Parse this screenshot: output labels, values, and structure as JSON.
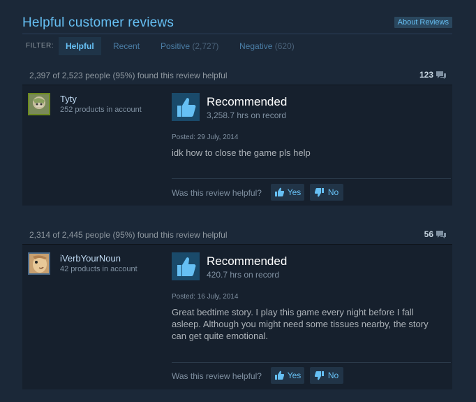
{
  "header": {
    "title": "Helpful customer reviews",
    "about_label": "About Reviews"
  },
  "filters": {
    "label": "FILTER:",
    "tabs": [
      {
        "label": "Helpful",
        "count": ""
      },
      {
        "label": "Recent",
        "count": ""
      },
      {
        "label": "Positive",
        "count": "(2,727)"
      },
      {
        "label": "Negative",
        "count": "(620)"
      }
    ],
    "active": "Helpful"
  },
  "reviews": [
    {
      "helpful_text": "2,397 of 2,523 people (95%) found this review helpful",
      "comment_count": "123",
      "username": "Tyty",
      "products": "252 products in account",
      "recommendation": "Recommended",
      "hours": "3,258.7 hrs on record",
      "posted": "Posted: 29 July, 2014",
      "content": "idk how to close the game pls help",
      "question": "Was this review helpful?",
      "yes_label": "Yes",
      "no_label": "No"
    },
    {
      "helpful_text": "2,314 of 2,445 people (95%) found this review helpful",
      "comment_count": "56",
      "username": "iVerbYourNoun",
      "products": "42 products in account",
      "recommendation": "Recommended",
      "hours": "420.7 hrs on record",
      "posted": "Posted: 16 July, 2014",
      "content": "Great bedtime story. I play this game every night before I fall asleep. Although you might need some tissues nearby, the story can get quite emotional.",
      "question": "Was this review helpful?",
      "yes_label": "Yes",
      "no_label": "No"
    }
  ],
  "colors": {
    "background": "#1b2838",
    "accent": "#66c0f4",
    "card": "#16202d",
    "thumb_bg": "#1a4a6a"
  },
  "icons": {
    "comment": "speech-bubble-icon",
    "thumb_up": "thumbs-up-icon",
    "thumb_down": "thumbs-down-icon"
  }
}
